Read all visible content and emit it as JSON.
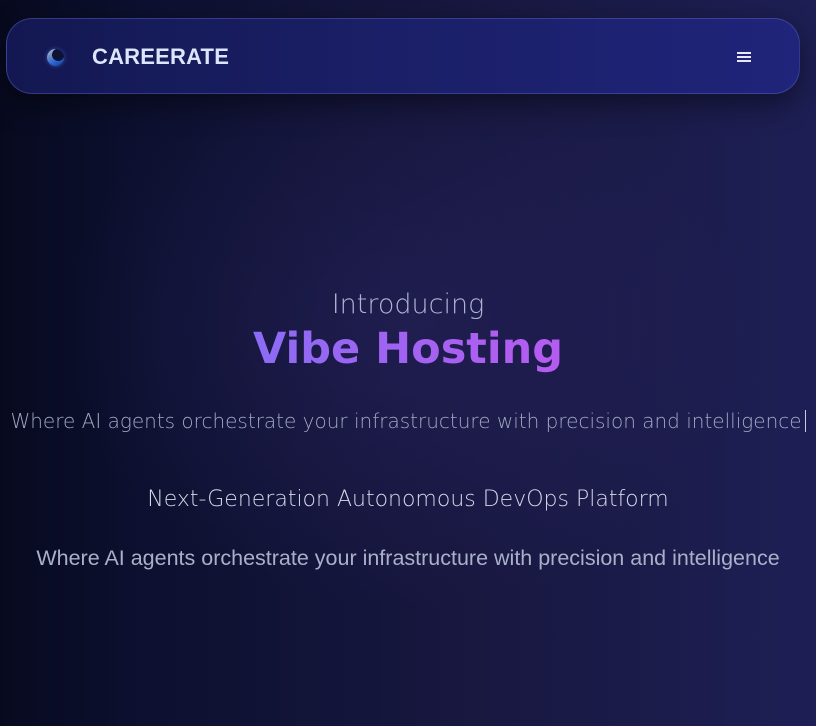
{
  "navbar": {
    "brand_name": "CAREERATE",
    "logo_icon": "globe-logo-icon",
    "menu_icon": "hamburger-menu-icon"
  },
  "hero": {
    "intro": "Introducing",
    "headline": "Vibe Hosting",
    "typewriter_text": "Where AI agents orchestrate your infrastructure with precision and intelligence",
    "subtitle": "Next-Generation Autonomous DevOps Platform",
    "tagline": "Where AI agents orchestrate your infrastructure with precision and intelligence"
  },
  "colors": {
    "background_left": "#070a1f",
    "background_right": "#1d1f55",
    "navbar": "#1a1f66",
    "headline_gradient_start": "#8b6cf4",
    "headline_gradient_end": "#b65cf0"
  }
}
